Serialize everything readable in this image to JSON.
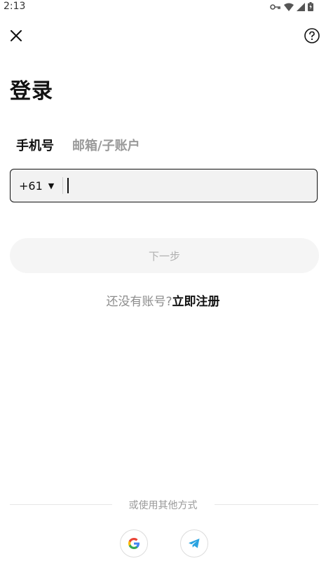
{
  "status_bar": {
    "time": "2:13"
  },
  "header": {
    "close_icon": "close-icon",
    "help_icon": "help-icon"
  },
  "title": "登录",
  "tabs": [
    {
      "label": "手机号",
      "active": true
    },
    {
      "label": "邮箱/子账户",
      "active": false
    }
  ],
  "phone": {
    "country_code": "+61",
    "value": ""
  },
  "next_button": "下一步",
  "register": {
    "question": "还没有账号?",
    "link": "立即注册"
  },
  "other_login": {
    "label": "或使用其他方式",
    "providers": [
      {
        "name": "google-icon"
      },
      {
        "name": "telegram-icon"
      }
    ]
  },
  "colors": {
    "accent": "#111111",
    "muted": "#9a9a9a",
    "button_bg": "#f5f5f5"
  }
}
